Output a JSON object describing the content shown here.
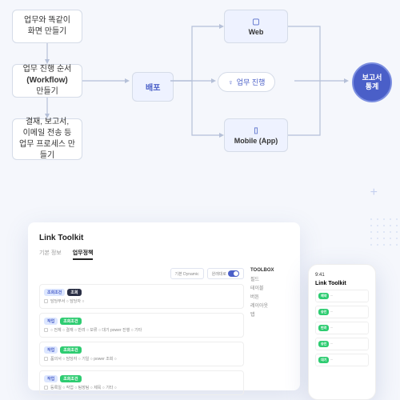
{
  "diagram": {
    "step1": "업무와 똑같이\n화면 만들기",
    "step2_a": "업무 진행 순서",
    "step2_b": "(Workflow)",
    "step2_c": "만들기",
    "step3": "결재, 보고서,\n이메일 전송 등\n업무 프로세스 만들기",
    "deploy": "배포",
    "web": "Web",
    "mobile": "Mobile (App)",
    "progress": "업무 진행",
    "report": "보고서\n통계"
  },
  "laptop": {
    "title": "Link Toolkit",
    "tabs": [
      "기본 정보",
      "업무정책"
    ],
    "toolbox": "TOOLBOX",
    "tb_items": [
      "필드",
      "테이블",
      "버튼",
      "레이아웃",
      "탭"
    ],
    "top_actions": [
      "기본 Dynamic",
      "원래대로"
    ],
    "cards": [
      {
        "label1": "조회조건",
        "label2": "조회",
        "green": "",
        "line": "담당부서 ○ 담당자 ○"
      },
      {
        "label1": "작업",
        "label2": "",
        "green": "조회조건",
        "line": "○ 전체 ○ 결재 ○ 반려 ○ 보류 ○ 대기 power 진행 ○ 기타"
      },
      {
        "label1": "작업",
        "label2": "",
        "green": "조회조건",
        "line": "품의서 ○ 담당자 ○ 기일 ○ power 조회 ○"
      },
      {
        "label1": "작업",
        "label2": "",
        "green": "조회조건",
        "line": "등록일 ○ 작업 ○ 팀장팀 ○ 제목 ○ 기타 ○"
      }
    ]
  },
  "phone": {
    "time": "9:41",
    "title": "Link Toolkit",
    "items": [
      "예약",
      "승인",
      "반려",
      "승인",
      "대기"
    ]
  }
}
